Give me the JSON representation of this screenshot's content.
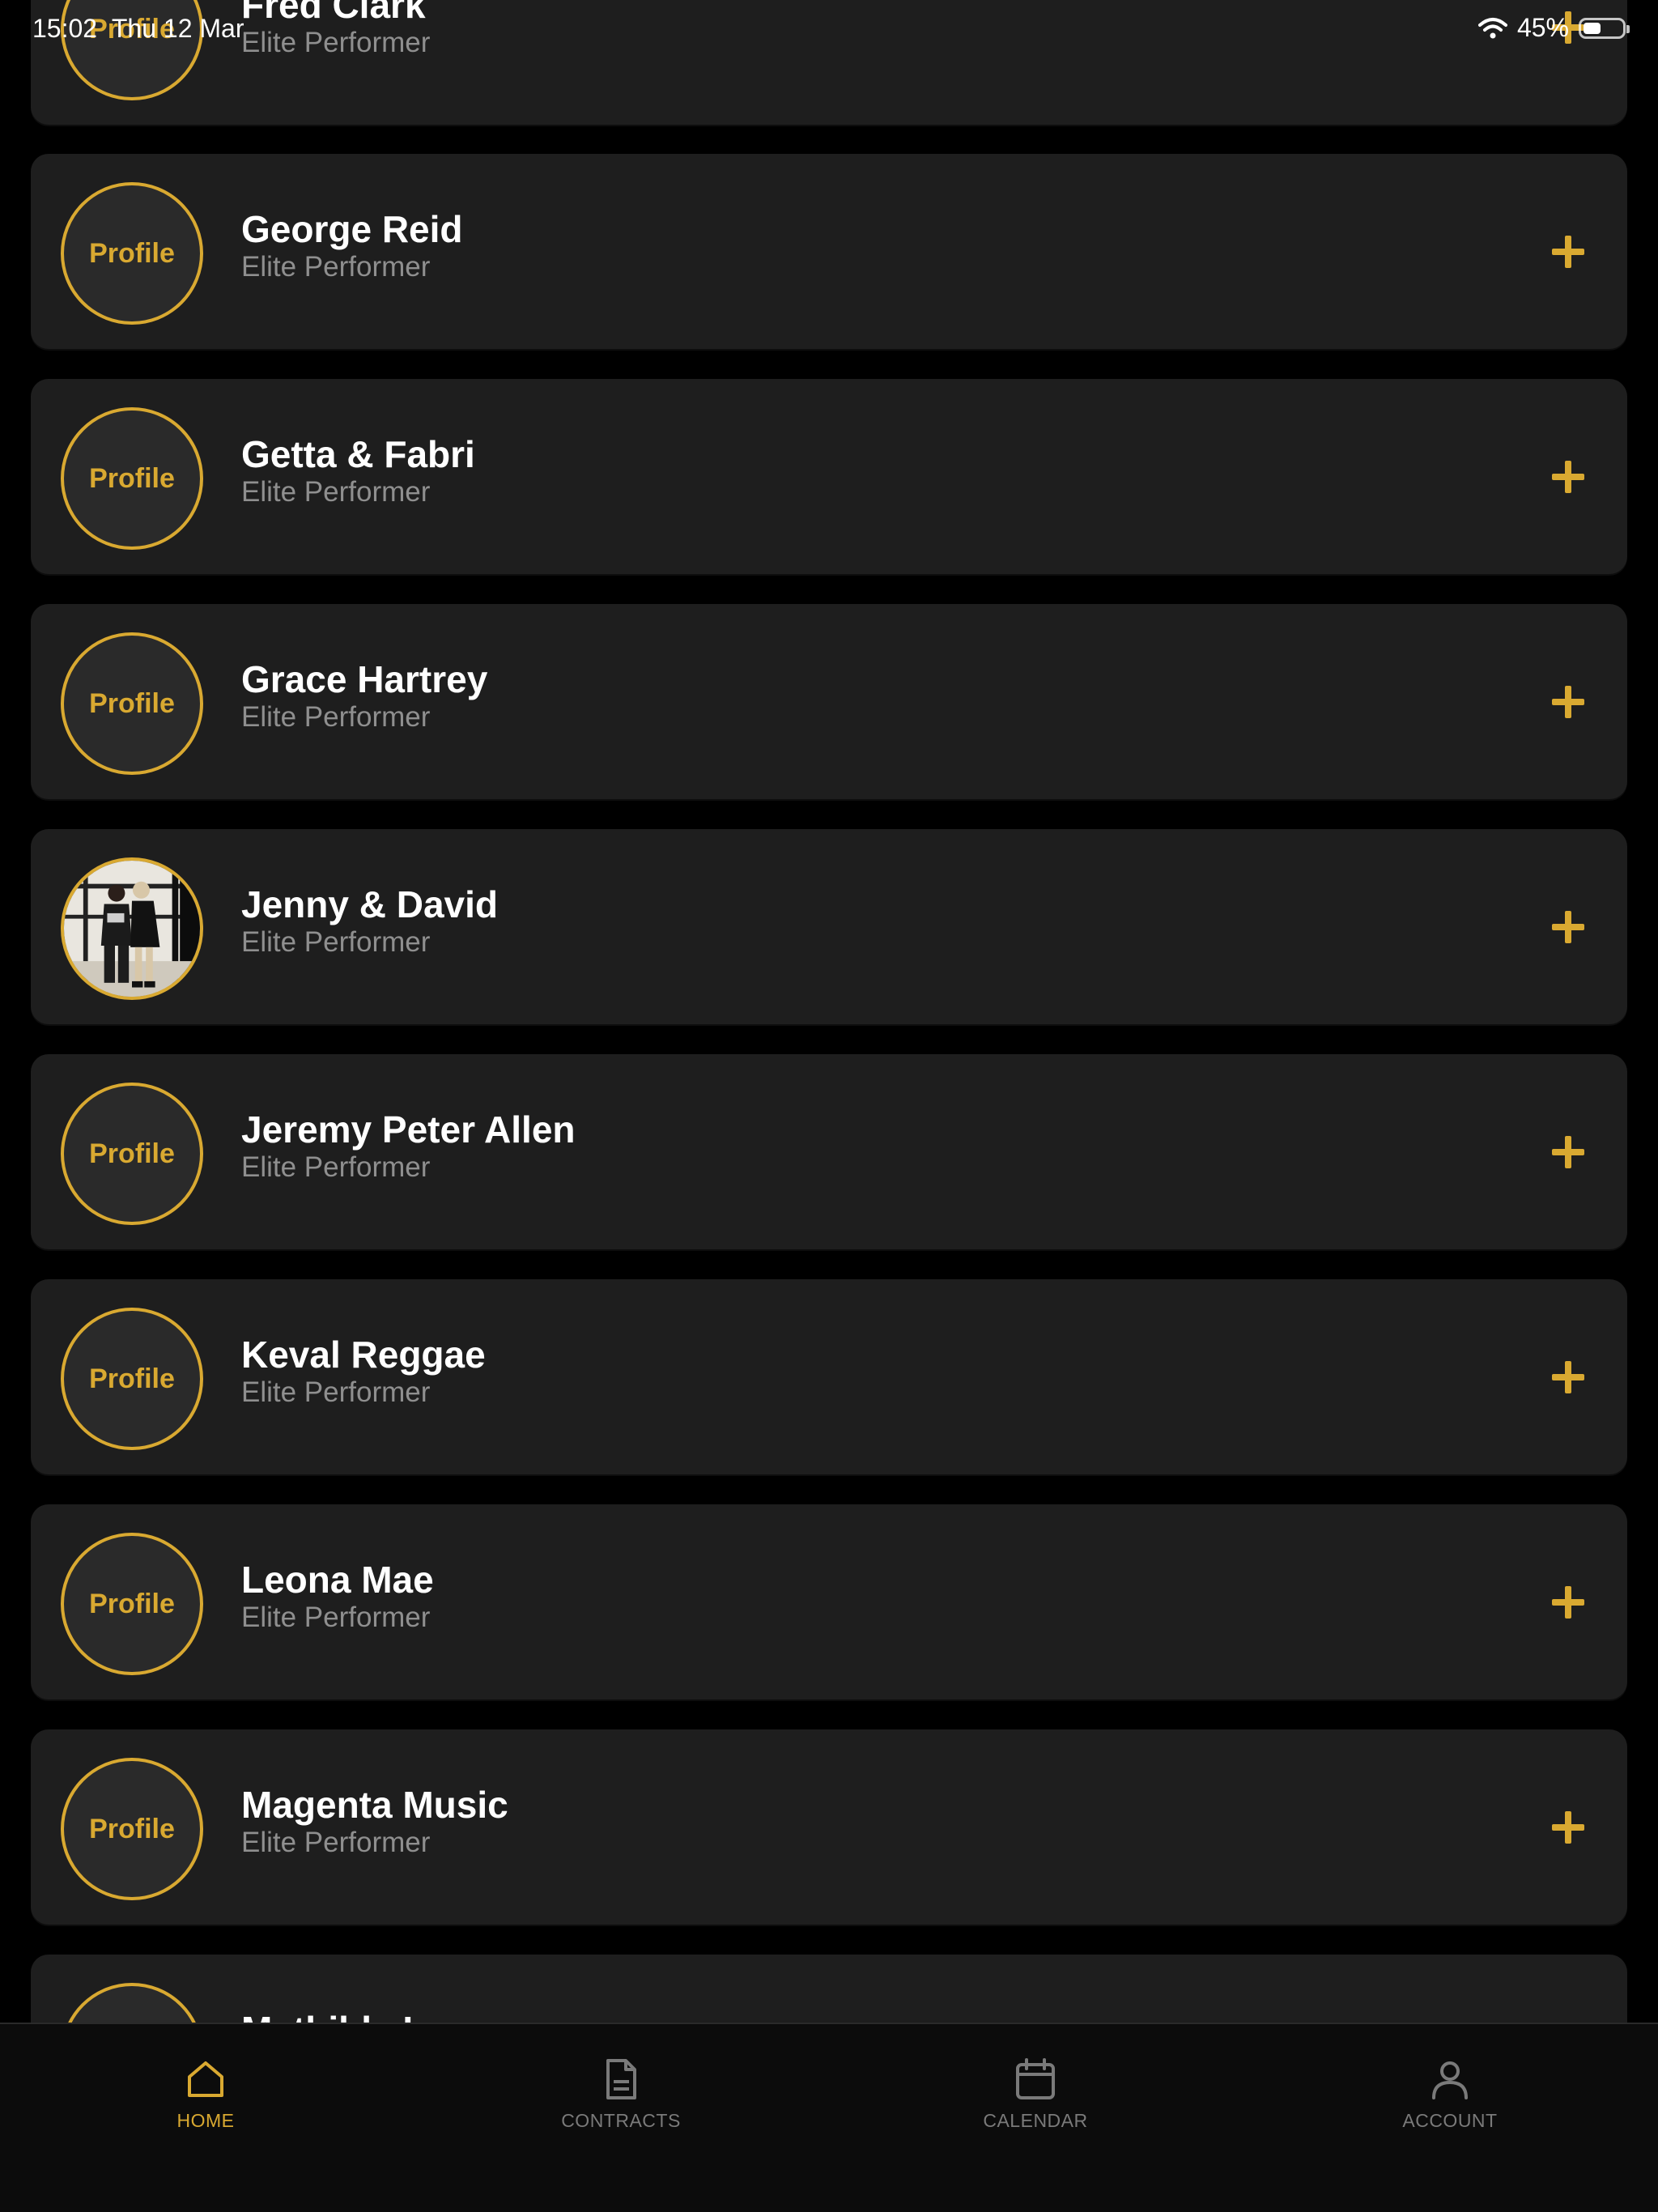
{
  "status_bar": {
    "time": "15:02",
    "date": "Thu 12 Mar",
    "battery_text": "45%",
    "battery_level": 0.45
  },
  "colors": {
    "accent": "#d9a931",
    "card": "#1e1e1e",
    "background": "#000000",
    "subtitle": "#8f8f8f"
  },
  "performers": [
    {
      "avatar_label": "Profile",
      "name": "Fred Clark",
      "subtitle": "Elite Performer",
      "avatar_type": "placeholder"
    },
    {
      "avatar_label": "Profile",
      "name": "George Reid",
      "subtitle": "Elite Performer",
      "avatar_type": "placeholder"
    },
    {
      "avatar_label": "Profile",
      "name": "Getta & Fabri",
      "subtitle": "Elite Performer",
      "avatar_type": "placeholder"
    },
    {
      "avatar_label": "Profile",
      "name": "Grace Hartrey",
      "subtitle": "Elite Performer",
      "avatar_type": "placeholder"
    },
    {
      "avatar_label": "",
      "name": "Jenny & David",
      "subtitle": "Elite Performer",
      "avatar_type": "photo"
    },
    {
      "avatar_label": "Profile",
      "name": "Jeremy Peter Allen",
      "subtitle": "Elite Performer",
      "avatar_type": "placeholder"
    },
    {
      "avatar_label": "Profile",
      "name": "Keval Reggae",
      "subtitle": "Elite Performer",
      "avatar_type": "placeholder"
    },
    {
      "avatar_label": "Profile",
      "name": "Leona Mae",
      "subtitle": "Elite Performer",
      "avatar_type": "placeholder"
    },
    {
      "avatar_label": "Profile",
      "name": "Magenta Music",
      "subtitle": "Elite Performer",
      "avatar_type": "placeholder"
    },
    {
      "avatar_label": "",
      "name": "Mathilda Lo",
      "subtitle": "",
      "avatar_type": "placeholder"
    }
  ],
  "tabs": [
    {
      "label": "HOME",
      "icon": "home-icon",
      "active": true
    },
    {
      "label": "CONTRACTS",
      "icon": "document-icon",
      "active": false
    },
    {
      "label": "CALENDAR",
      "icon": "calendar-icon",
      "active": false
    },
    {
      "label": "ACCOUNT",
      "icon": "user-icon",
      "active": false
    }
  ]
}
